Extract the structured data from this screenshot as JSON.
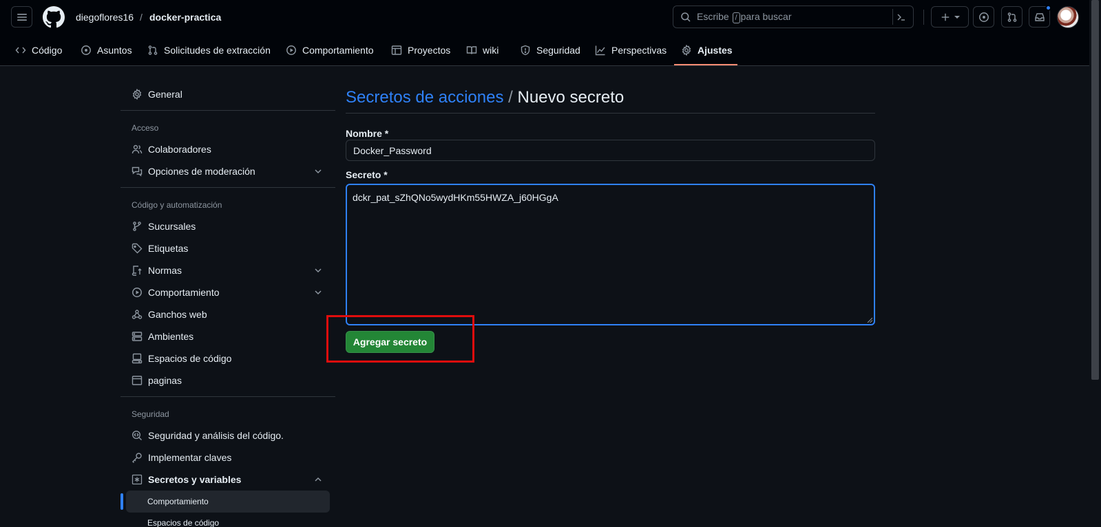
{
  "header": {
    "owner": "diegoflores16",
    "slash": "/",
    "repo": "docker-practica",
    "search_prefix": "Escribe",
    "search_key": "/",
    "search_suffix": "para buscar"
  },
  "tabs": [
    {
      "label": "Código",
      "icon": "code-icon"
    },
    {
      "label": "Asuntos",
      "icon": "issue-icon"
    },
    {
      "label": "Solicitudes de extracción",
      "icon": "pull-request-icon"
    },
    {
      "label": "Comportamiento",
      "icon": "play-icon"
    },
    {
      "label": "Proyectos",
      "icon": "table-icon"
    },
    {
      "label": "wiki",
      "icon": "book-icon"
    },
    {
      "label": "Seguridad",
      "icon": "shield-icon"
    },
    {
      "label": "Perspectivas",
      "icon": "graph-icon"
    },
    {
      "label": "Ajustes",
      "icon": "gear-icon",
      "active": true
    }
  ],
  "sidebar": {
    "general": "General",
    "groups": {
      "access": "Acceso",
      "code_automation": "Código y automatización",
      "security": "Seguridad"
    },
    "items": {
      "collaborators": "Colaboradores",
      "moderation": "Opciones de moderación",
      "branches": "Sucursales",
      "tags": "Etiquetas",
      "rules": "Normas",
      "actions": "Comportamiento",
      "webhooks": "Ganchos web",
      "environments": "Ambientes",
      "codespaces": "Espacios de código",
      "pages": "paginas",
      "code_security": "Seguridad y análisis del código.",
      "deploy_keys": "Implementar claves",
      "secrets": "Secretos y variables"
    },
    "sub_items": {
      "actions": "Comportamiento",
      "codespaces": "Espacios de código"
    }
  },
  "main": {
    "breadcrumb_link": "Secretos de acciones",
    "breadcrumb_sep": "/",
    "breadcrumb_current": "Nuevo secreto",
    "name_label": "Nombre *",
    "name_value": "Docker_Password",
    "secret_label": "Secreto *",
    "secret_value": "dckr_pat_sZhQNo5wydHKm55HWZA_j60HGgA",
    "submit_label": "Agregar secreto"
  },
  "colors": {
    "accent": "#2f81f7",
    "submit": "#238636",
    "tab_underline": "#fd8c73",
    "highlight": "#e00d0d"
  }
}
